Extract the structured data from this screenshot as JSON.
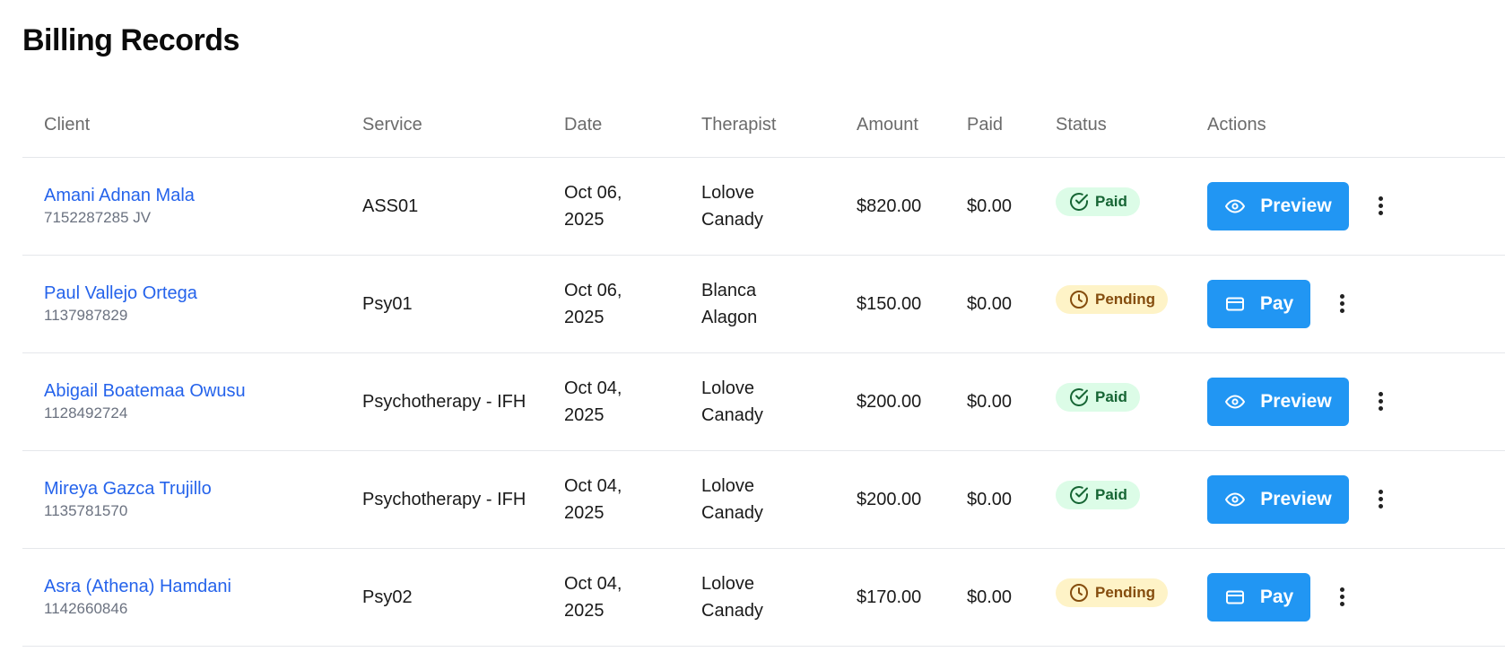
{
  "page": {
    "title": "Billing Records"
  },
  "table": {
    "headers": {
      "client": "Client",
      "service": "Service",
      "date": "Date",
      "therapist": "Therapist",
      "amount": "Amount",
      "paid": "Paid",
      "status": "Status",
      "actions": "Actions"
    },
    "rows": [
      {
        "client_name": "Amani Adnan Mala",
        "client_id": "7152287285 JV",
        "service": "ASS01",
        "date": "Oct 06, 2025",
        "therapist": "Lolove Canady",
        "amount": "$820.00",
        "paid": "$0.00",
        "status": "Paid",
        "action": "Preview",
        "action_icon": "eye-icon"
      },
      {
        "client_name": "Paul Vallejo Ortega",
        "client_id": "1137987829",
        "service": "Psy01",
        "date": "Oct 06, 2025",
        "therapist": "Blanca Alagon",
        "amount": "$150.00",
        "paid": "$0.00",
        "status": "Pending",
        "action": "Pay",
        "action_icon": "credit-card-icon"
      },
      {
        "client_name": "Abigail Boatemaa Owusu",
        "client_id": "1128492724",
        "service": "Psychotherapy - IFH",
        "date": "Oct 04, 2025",
        "therapist": "Lolove Canady",
        "amount": "$200.00",
        "paid": "$0.00",
        "status": "Paid",
        "action": "Preview",
        "action_icon": "eye-icon"
      },
      {
        "client_name": "Mireya Gazca Trujillo",
        "client_id": "1135781570",
        "service": "Psychotherapy - IFH",
        "date": "Oct 04, 2025",
        "therapist": "Lolove Canady",
        "amount": "$200.00",
        "paid": "$0.00",
        "status": "Paid",
        "action": "Preview",
        "action_icon": "eye-icon"
      },
      {
        "client_name": "Asra (Athena) Hamdani",
        "client_id": "1142660846",
        "service": "Psy02",
        "date": "Oct 04, 2025",
        "therapist": "Lolove Canady",
        "amount": "$170.00",
        "paid": "$0.00",
        "status": "Pending",
        "action": "Pay",
        "action_icon": "credit-card-icon"
      }
    ]
  },
  "colors": {
    "link": "#2563eb",
    "primary_button": "#2196f3",
    "status_paid_bg": "#dcfce7",
    "status_paid_text": "#166534",
    "status_pending_bg": "#fef3c7",
    "status_pending_text": "#854d0e"
  }
}
